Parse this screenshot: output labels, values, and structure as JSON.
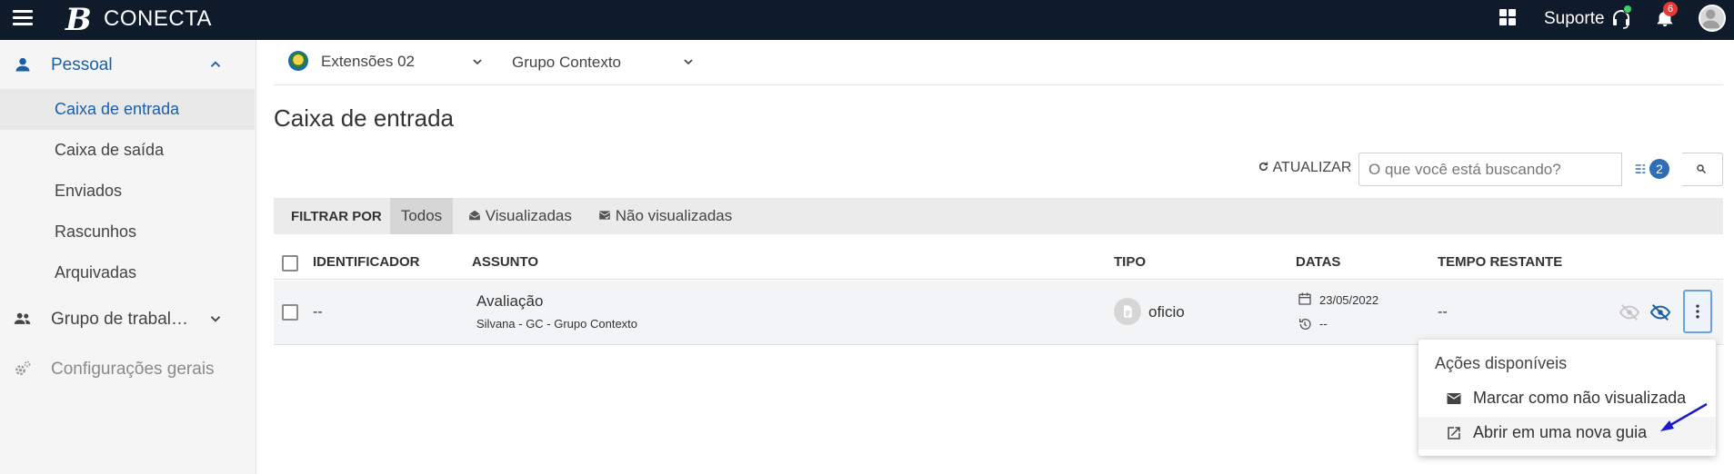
{
  "app": {
    "logo_letter": "B",
    "name": "CONECTA"
  },
  "topbar": {
    "support_label": "Suporte",
    "notification_count": "6"
  },
  "sidebar": {
    "sections": [
      {
        "label": "Pessoal",
        "expanded": true
      },
      {
        "label": "Grupo de trabal…",
        "expanded": false
      },
      {
        "label": "Configurações gerais"
      }
    ],
    "items": [
      {
        "label": "Caixa de entrada",
        "active": true
      },
      {
        "label": "Caixa de saída"
      },
      {
        "label": "Enviados"
      },
      {
        "label": "Rascunhos"
      },
      {
        "label": "Arquivadas"
      }
    ]
  },
  "context": {
    "organization": "Extensões 02",
    "group": "Grupo Contexto"
  },
  "page": {
    "title": "Caixa de entrada"
  },
  "toolbar": {
    "refresh_label": "ATUALIZAR",
    "search_placeholder": "O que você está buscando?",
    "filter_count": "2"
  },
  "filters": {
    "label": "FILTRAR POR",
    "tabs": [
      {
        "label": "Todos",
        "selected": true
      },
      {
        "label": "Visualizadas"
      },
      {
        "label": "Não visualizadas"
      }
    ]
  },
  "table": {
    "columns": [
      "IDENTIFICADOR",
      "ASSUNTO",
      "TIPO",
      "DATAS",
      "TEMPO RESTANTE"
    ],
    "rows": [
      {
        "identifier": "--",
        "subject": "Avaliação",
        "subject_detail": "Silvana - GC - Grupo Contexto",
        "type": "oficio",
        "date": "23/05/2022",
        "deadline": "--",
        "time_remaining": "--"
      }
    ]
  },
  "menu": {
    "title": "Ações disponíveis",
    "items": [
      {
        "label": "Marcar como não visualizada",
        "icon": "mail-icon"
      },
      {
        "label": "Abrir em uma nova guia",
        "icon": "open-in-new-icon"
      }
    ]
  },
  "colors": {
    "topbar": "#0f1a2a",
    "accent": "#1a5fa8",
    "badge": "#e53935",
    "online": "#3ad06a"
  }
}
